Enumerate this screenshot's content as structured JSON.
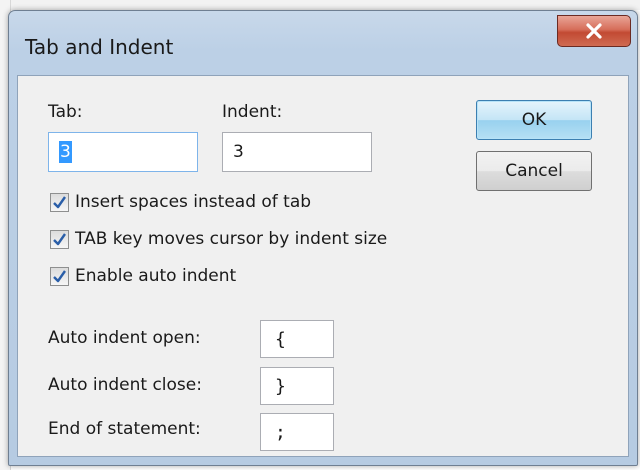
{
  "dialog": {
    "title": "Tab and Indent",
    "close_label": "X"
  },
  "tab": {
    "label": "Tab:",
    "value": "3"
  },
  "indent": {
    "label": "Indent:",
    "value": "3"
  },
  "buttons": {
    "ok_label": "OK",
    "cancel_label": "Cancel"
  },
  "options": [
    {
      "label": "Insert spaces instead of tab",
      "checked": true
    },
    {
      "label": "TAB key moves cursor by indent size",
      "checked": true
    },
    {
      "label": "Enable auto indent",
      "checked": true
    }
  ],
  "auto_indent": {
    "open_label": "Auto indent open:",
    "open_value": "{",
    "close_label": "Auto indent close:",
    "close_value": "}",
    "statement_label": "End of statement:",
    "statement_value": ";"
  },
  "colors": {
    "selection": "#3399ff",
    "checkmark": "#2a5ea8",
    "close_button": "#c24a33"
  },
  "icons": {
    "close": "close-icon",
    "check": "checkmark-icon"
  }
}
